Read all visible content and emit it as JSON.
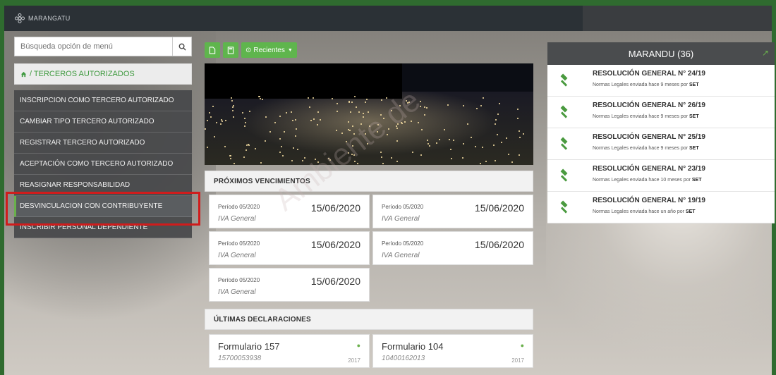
{
  "app": {
    "title": "MARANGATU"
  },
  "colors": {
    "accent": "#5fb54d",
    "dark": "#2b3136",
    "highlight": "#d01c1c"
  },
  "search": {
    "placeholder": "Búsqueda opción de menú"
  },
  "breadcrumb": {
    "label": "/ TERCEROS AUTORIZADOS"
  },
  "menu": {
    "items": [
      {
        "label": "INSCRIPCION COMO TERCERO AUTORIZADO"
      },
      {
        "label": "CAMBIAR TIPO TERCERO AUTORIZADO"
      },
      {
        "label": "REGISTRAR TERCERO AUTORIZADO"
      },
      {
        "label": "ACEPTACIÓN COMO TERCERO AUTORIZADO"
      },
      {
        "label": "REASIGNAR RESPONSABILIDAD"
      },
      {
        "label": "DESVINCULACION CON CONTRIBUYENTE"
      },
      {
        "label": "INSCRIBIR PERSONAL DEPENDIENTE"
      }
    ]
  },
  "toolbar": {
    "recientes_label": "Recientes"
  },
  "vencimientos": {
    "title": "PRÓXIMOS VENCIMIENTOS",
    "cards": [
      {
        "period": "Período 05/2020",
        "tax": "IVA General",
        "date": "15/06/2020"
      },
      {
        "period": "Período 05/2020",
        "tax": "IVA General",
        "date": "15/06/2020"
      },
      {
        "period": "Período 05/2020",
        "tax": "IVA General",
        "date": "15/06/2020"
      },
      {
        "period": "Período 05/2020",
        "tax": "IVA General",
        "date": "15/06/2020"
      },
      {
        "period": "Período 05/2020",
        "tax": "IVA General",
        "date": "15/06/2020"
      }
    ]
  },
  "declaraciones": {
    "title": "ÚLTIMAS DECLARACIONES",
    "cards": [
      {
        "form": "Formulario 157",
        "number": "15700053938",
        "year": "2017"
      },
      {
        "form": "Formulario 104",
        "number": "10400162013",
        "year": "2017"
      }
    ]
  },
  "marandu": {
    "title": "MARANDU (36)",
    "items": [
      {
        "title": "RESOLUCIÓN GENERAL N° 24/19",
        "sub": "Normas Legales enviada hace 9 meses por",
        "sender": "SET"
      },
      {
        "title": "RESOLUCIÓN GENERAL N° 26/19",
        "sub": "Normas Legales enviada hace 9 meses por",
        "sender": "SET"
      },
      {
        "title": "RESOLUCIÓN GENERAL N° 25/19",
        "sub": "Normas Legales enviada hace 9 meses por",
        "sender": "SET"
      },
      {
        "title": "RESOLUCIÓN GENERAL N° 23/19",
        "sub": "Normas Legales enviada hace 10 meses por",
        "sender": "SET"
      },
      {
        "title": "RESOLUCIÓN GENERAL N° 19/19",
        "sub": "Normas Legales enviada hace un año por",
        "sender": "SET"
      }
    ]
  },
  "watermark": "Ambiente de"
}
